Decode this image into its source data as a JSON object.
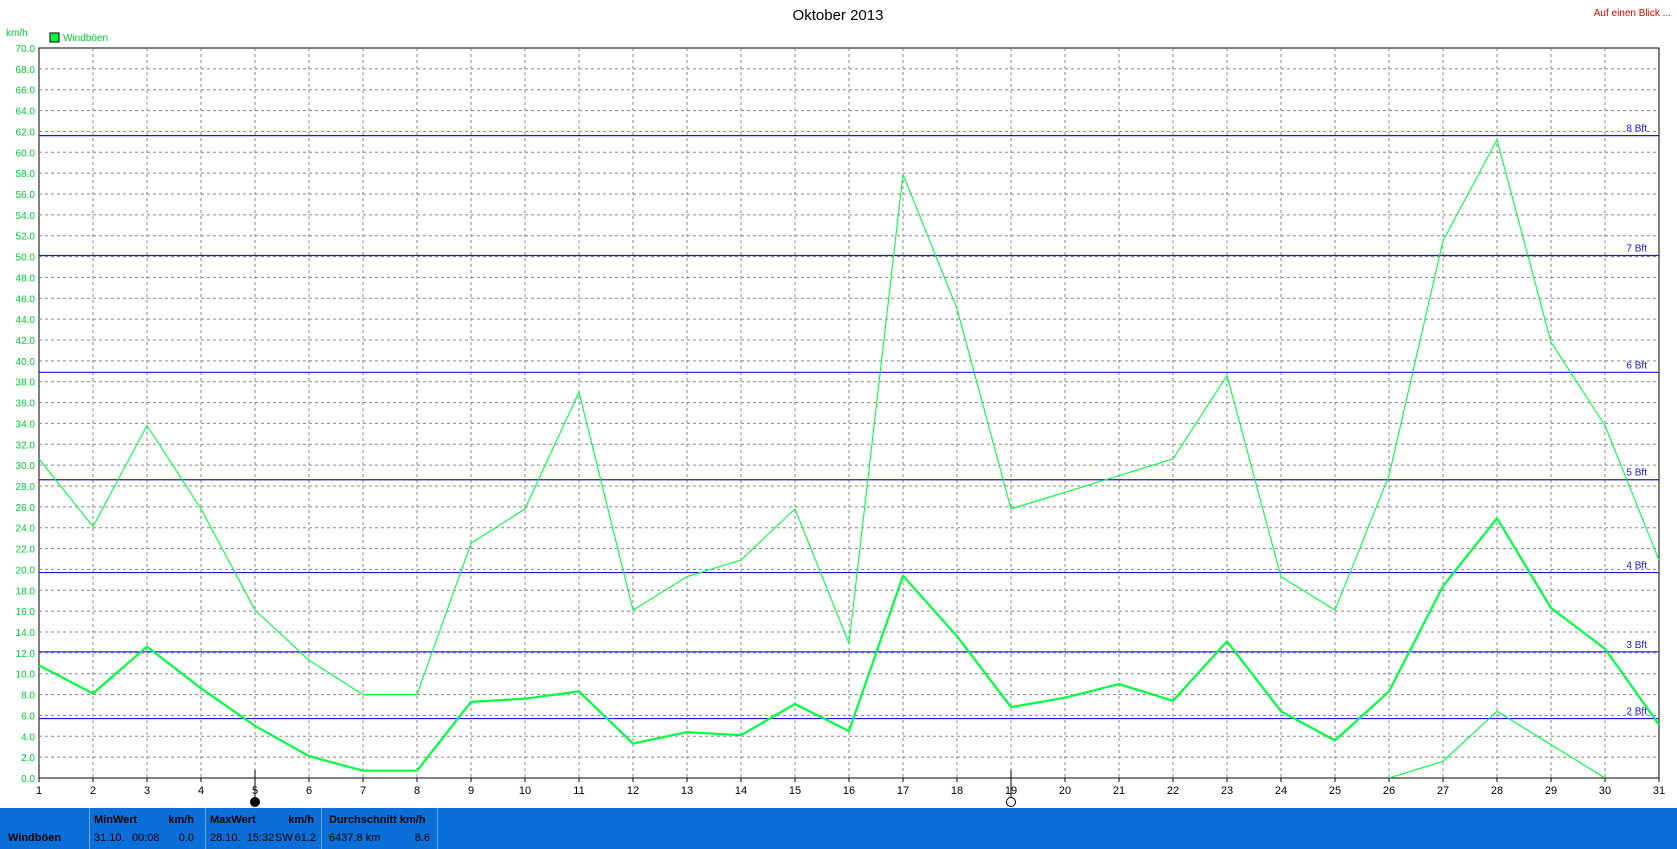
{
  "chart_data": {
    "type": "line",
    "title": "Oktober 2013",
    "ylabel": "km/h",
    "x": [
      1,
      2,
      3,
      4,
      5,
      6,
      7,
      8,
      9,
      10,
      11,
      12,
      13,
      14,
      15,
      16,
      17,
      18,
      19,
      20,
      21,
      22,
      23,
      24,
      25,
      26,
      27,
      28,
      29,
      30,
      31
    ],
    "x_tick_labels": [
      "1",
      "2",
      "3",
      "4",
      "5",
      "6",
      "7",
      "8",
      "9",
      "10",
      "11",
      "12",
      "13",
      "14",
      "15",
      "16",
      "17",
      "18",
      "19",
      "20",
      "21",
      "22",
      "23",
      "24",
      "25",
      "26",
      "27",
      "28",
      "29",
      "30",
      "31"
    ],
    "ylim": [
      0,
      70
    ],
    "y_tick_labels": [
      "0.0",
      "2.0",
      "4.0",
      "6.0",
      "8.0",
      "10.0",
      "12.0",
      "14.0",
      "16.0",
      "18.0",
      "20.0",
      "22.0",
      "24.0",
      "26.0",
      "28.0",
      "30.0",
      "32.0",
      "34.0",
      "36.0",
      "38.0",
      "40.0",
      "42.0",
      "44.0",
      "46.0",
      "48.0",
      "50.0",
      "52.0",
      "54.0",
      "56.0",
      "58.0",
      "60.0",
      "62.0",
      "64.0",
      "66.0",
      "68.0",
      "70.0"
    ],
    "grid": true,
    "legend": {
      "placement": "top-left",
      "entries": [
        "Windböen"
      ]
    },
    "series": [
      {
        "name": "Windböen",
        "role": "max",
        "color": "#00ff40",
        "values": [
          30.6,
          24.1,
          33.8,
          25.8,
          16.1,
          11.3,
          8.0,
          8.0,
          22.5,
          25.8,
          37.0,
          16.1,
          19.3,
          20.9,
          25.8,
          12.9,
          57.9,
          45.0,
          25.8,
          27.4,
          29.0,
          30.6,
          38.6,
          19.3,
          16.1,
          29.0,
          51.5,
          61.2,
          41.8,
          33.8,
          20.9
        ]
      },
      {
        "name": "Windböen",
        "role": "avg",
        "color": "#00ff40",
        "values": [
          10.8,
          8.1,
          12.6,
          8.6,
          5.0,
          2.1,
          0.7,
          0.7,
          7.3,
          7.6,
          8.3,
          3.3,
          4.4,
          4.1,
          7.1,
          4.5,
          19.4,
          13.6,
          6.8,
          7.7,
          9.0,
          7.4,
          13.1,
          6.4,
          3.6,
          8.3,
          18.4,
          24.9,
          16.3,
          12.4,
          5.1
        ]
      },
      {
        "role": "min",
        "color": "#00ff40",
        "x": [
          26,
          27,
          28,
          29,
          30
        ],
        "values": [
          0.0,
          1.6,
          6.4,
          3.2,
          0.0
        ]
      }
    ],
    "reference_lines": [
      {
        "label": "2 Bft",
        "value": 5.7
      },
      {
        "label": "3 Bft",
        "value": 12.1
      },
      {
        "label": "4 Bft",
        "value": 19.7
      },
      {
        "label": "5 Bft",
        "value": 28.6
      },
      {
        "label": "6 Bft",
        "value": 38.9
      },
      {
        "label": "7 Bft",
        "value": 50.1
      },
      {
        "label": "8 Bft",
        "value": 61.6
      }
    ],
    "reference_line_color": "#1a1acc",
    "moon_phases": [
      {
        "day": 5,
        "phase": "new-moon-icon"
      },
      {
        "day": 19,
        "phase": "full-moon-icon"
      }
    ]
  },
  "header": {
    "title": "Oktober 2013",
    "unit": "km/h",
    "legend_label": "Windböen",
    "link": "Auf einen Blick ...",
    "link_color": "#e00000"
  },
  "footer": {
    "series_label": "Windböen",
    "min": {
      "head": "MinWert",
      "unit": "km/h",
      "date": "31.10.",
      "time": "00:08",
      "value": "0.0"
    },
    "max": {
      "head": "MaxWert",
      "unit": "km/h",
      "datetime": "28.10.  15:32",
      "direction": "SW",
      "value": "61.2"
    },
    "avg": {
      "head": "Durchschnitt km/h",
      "distance": "6437.8 km",
      "value": "8.6"
    },
    "band_color": "#0a6fd8"
  }
}
